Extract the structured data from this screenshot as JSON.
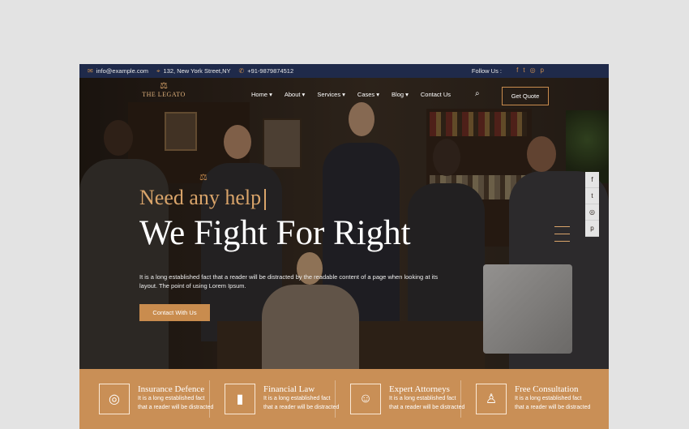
{
  "topbar": {
    "email": "info@example.com",
    "address": "132, New York Street,NY",
    "phone": "+91-9879874512",
    "follow_label": "Follow Us :",
    "socials": [
      "f",
      "t",
      "◎",
      "p"
    ]
  },
  "header": {
    "logo_crest": "⚖",
    "logo_text": "THE LEGATO",
    "nav": [
      "Home ▾",
      "About ▾",
      "Services ▾",
      "Cases ▾",
      "Blog ▾",
      "Contact Us"
    ],
    "search_icon": "⌕",
    "quote_label": "Get Quote"
  },
  "hero": {
    "scales_icon": "⚖",
    "tagline": "Need any help",
    "headline": "We Fight For Right",
    "description": "It is a long established fact that a reader will be distracted by the readable content of a page when looking at its layout. The point of using Lorem Ipsum.",
    "cta_label": "Contact With Us",
    "side_social": [
      "f",
      "t",
      "◎",
      "p"
    ]
  },
  "features": [
    {
      "icon": "◎",
      "title": "Insurance Defence",
      "text": "It is a long established fact that a reader will be distracted"
    },
    {
      "icon": "▮",
      "title": "Financial Law",
      "text": "It is a long established fact that a reader will be distracted"
    },
    {
      "icon": "☺",
      "title": "Expert Attorneys",
      "text": "It is a long established fact that a reader will be distracted"
    },
    {
      "icon": "♙",
      "title": "Free Consultation",
      "text": "It is a long established fact that a reader will be distracted"
    }
  ],
  "colors": {
    "accent": "#c98c4e",
    "topbar": "#1f2a4a",
    "band": "#c98f56"
  }
}
